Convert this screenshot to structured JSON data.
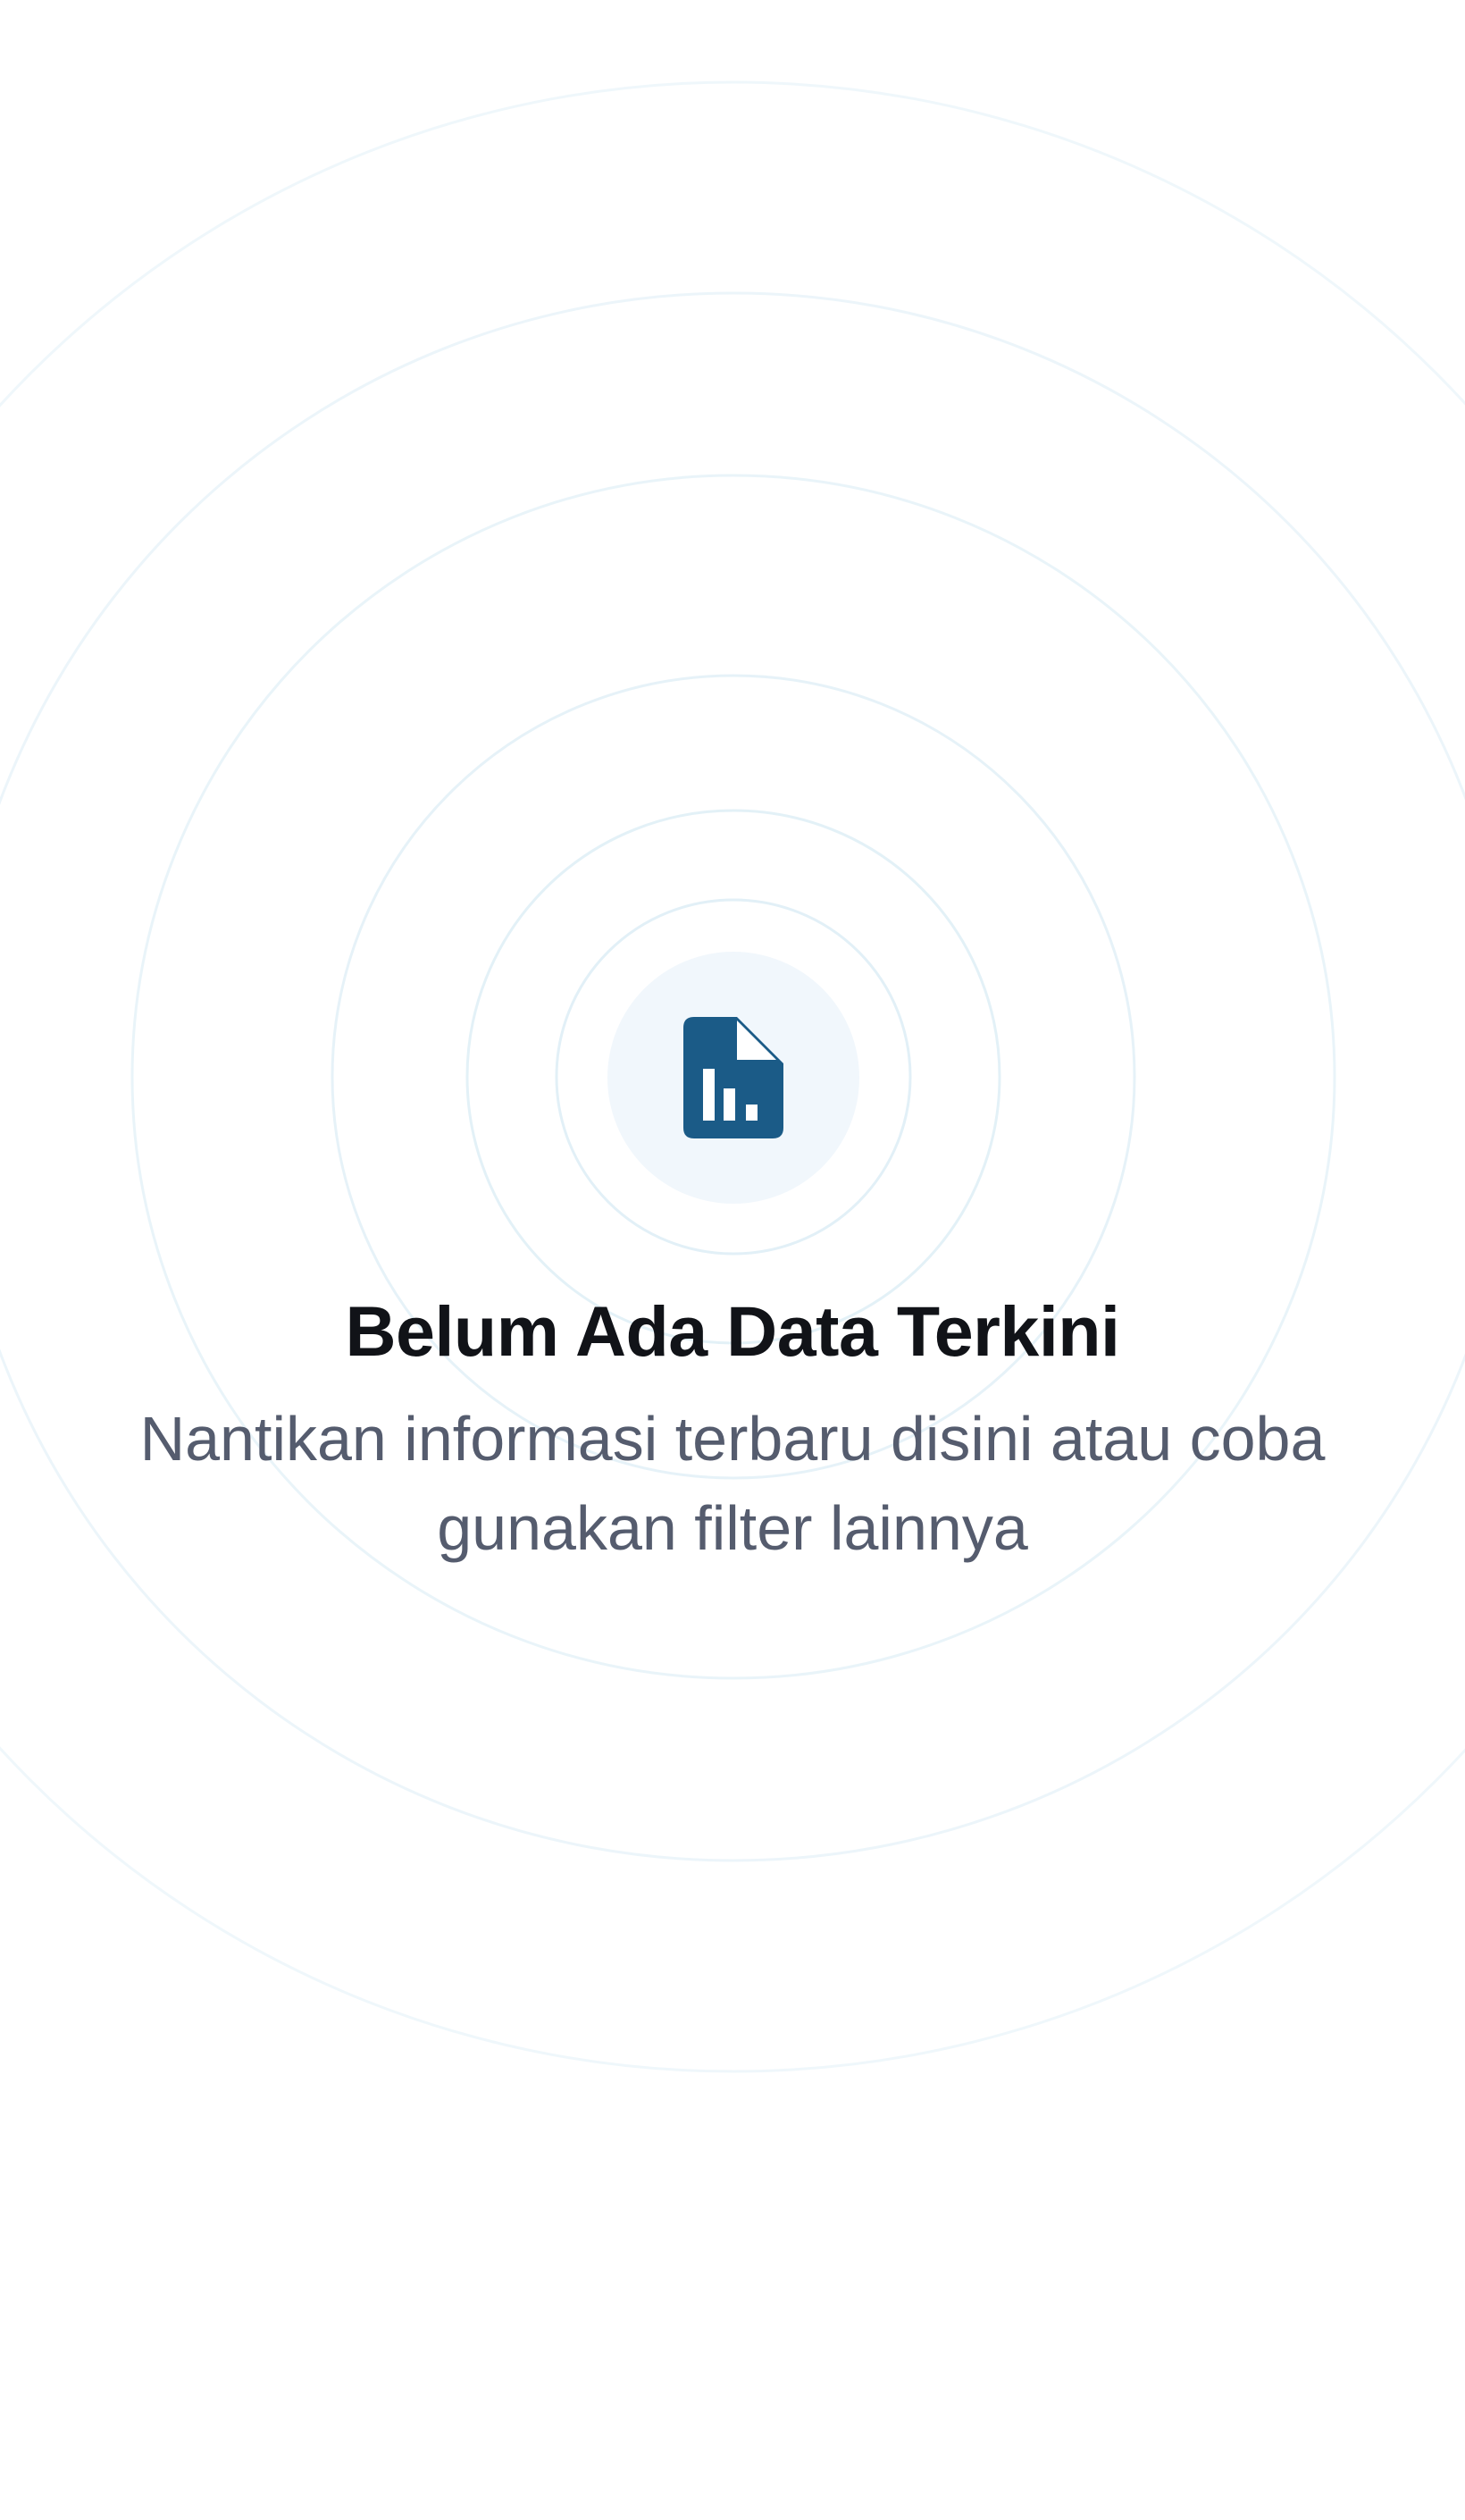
{
  "empty_state": {
    "icon": "file-chart-icon",
    "title": "Belum Ada Data Terkini",
    "message": "Nantikan informasi terbaru disini atau coba gunakan filter lainnya"
  },
  "colors": {
    "background": "#ffffff",
    "icon": "#1b5b87",
    "icon_badge": "#f1f7fc",
    "ripple_ring": "#e2f0f7",
    "title": "#111318",
    "message": "#555c6e"
  }
}
